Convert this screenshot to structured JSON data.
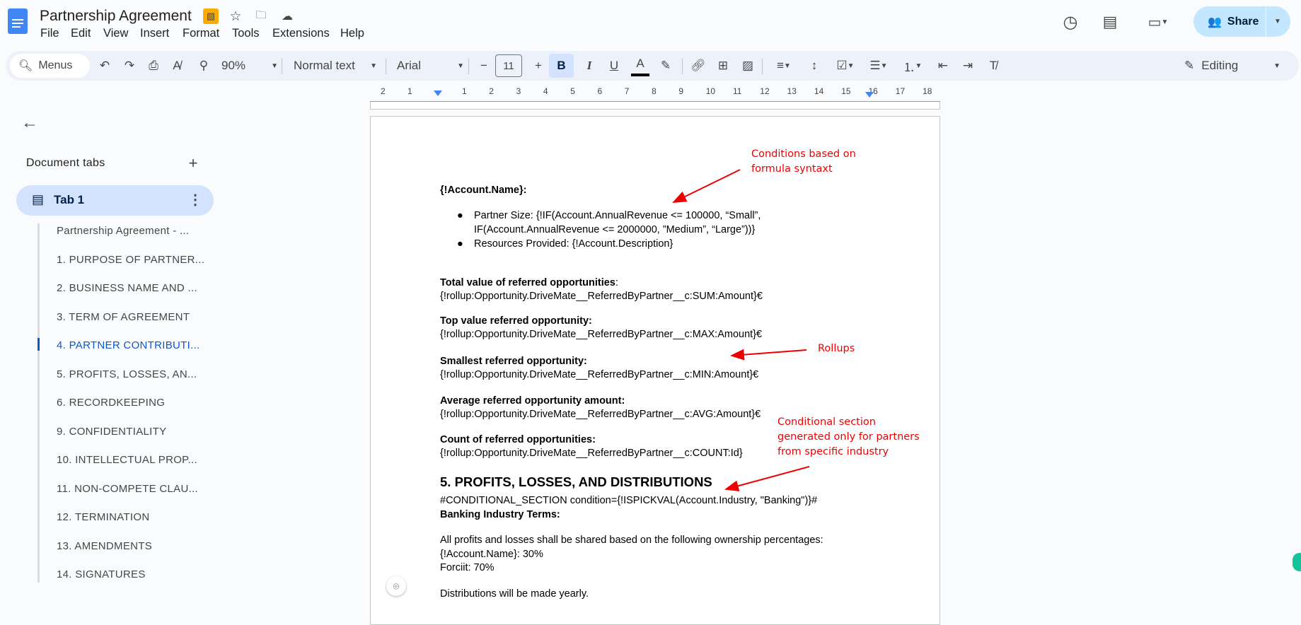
{
  "header": {
    "title": "Partnership Agreement",
    "menus": [
      "File",
      "Edit",
      "View",
      "Insert",
      "Format",
      "Tools",
      "Extensions",
      "Help"
    ],
    "share_label": "Share"
  },
  "toolbar": {
    "search_label": "Menus",
    "zoom": "90%",
    "style": "Normal text",
    "font": "Arial",
    "font_size": "11",
    "bold": "B",
    "italic": "I",
    "underline": "U",
    "text_color": "A",
    "mode": "Editing"
  },
  "ruler": {
    "numbers": [
      "2",
      "1",
      "1",
      "2",
      "3",
      "4",
      "5",
      "6",
      "7",
      "8",
      "9",
      "10",
      "11",
      "12",
      "13",
      "14",
      "15",
      "16",
      "17",
      "18"
    ]
  },
  "sidebar": {
    "title": "Document tabs",
    "tab": "Tab 1",
    "outline": [
      "Partnership Agreement - ...",
      "1. PURPOSE OF PARTNER...",
      "2. BUSINESS NAME AND ...",
      "3. TERM OF AGREEMENT",
      "4. PARTNER CONTRIBUTI...",
      "5. PROFITS, LOSSES, AN...",
      "6. RECORDKEEPING",
      "9. CONFIDENTIALITY",
      "10. INTELLECTUAL PROP...",
      "11. NON-COMPETE CLAU...",
      "12. TERMINATION",
      "13. AMENDMENTS",
      "14. SIGNATURES"
    ],
    "active_index": 4
  },
  "document": {
    "account_name": "{!Account.Name}:",
    "bullets": [
      "Partner Size: {!IF(Account.AnnualRevenue <= 100000, “Small”,",
      "IF(Account.AnnualRevenue <= 2000000, ”Medium”, “Large”))}",
      "Resources Provided: {!Account.Description}"
    ],
    "rollups": [
      {
        "label": "Total value of referred opportunities",
        "suffix": ":",
        "value": "{!rollup:Opportunity.DriveMate__ReferredByPartner__c:SUM:Amount}€"
      },
      {
        "label": "Top value referred opportunity:",
        "suffix": "",
        "value": "{!rollup:Opportunity.DriveMate__ReferredByPartner__c:MAX:Amount}€"
      },
      {
        "label": "Smallest referred opportunity:",
        "suffix": "",
        "value": "{!rollup:Opportunity.DriveMate__ReferredByPartner__c:MIN:Amount}€"
      },
      {
        "label": "Average referred opportunity amount:",
        "suffix": "",
        "value": "{!rollup:Opportunity.DriveMate__ReferredByPartner__c:AVG:Amount}€"
      },
      {
        "label": "Count of referred opportunities:",
        "suffix": "",
        "value": "{!rollup:Opportunity.DriveMate__ReferredByPartner__c:COUNT:Id}"
      }
    ],
    "heading": "5. PROFITS, LOSSES, AND DISTRIBUTIONS",
    "conditional": "#CONDITIONAL_SECTION condition={!ISPICKVAL(Account.Industry, \"Banking\")}#",
    "banking": "Banking Industry Terms:",
    "profits": [
      "All profits and losses shall be shared based on the following ownership percentages:",
      "{!Account.Name}: 30%",
      "Forciit: 70%"
    ],
    "distributions": "Distributions will be made yearly."
  },
  "annotations": {
    "formula": [
      "Conditions based on",
      "formula syntaxt"
    ],
    "rollups": "Rollups",
    "conditional": [
      "Conditional section",
      "generated only for partners",
      "from specific industry"
    ],
    "color": "#e00000"
  },
  "colors": {
    "accent": "#0b57d0",
    "share_bg": "#c2e7ff",
    "tab_bg": "#d3e3fd"
  }
}
